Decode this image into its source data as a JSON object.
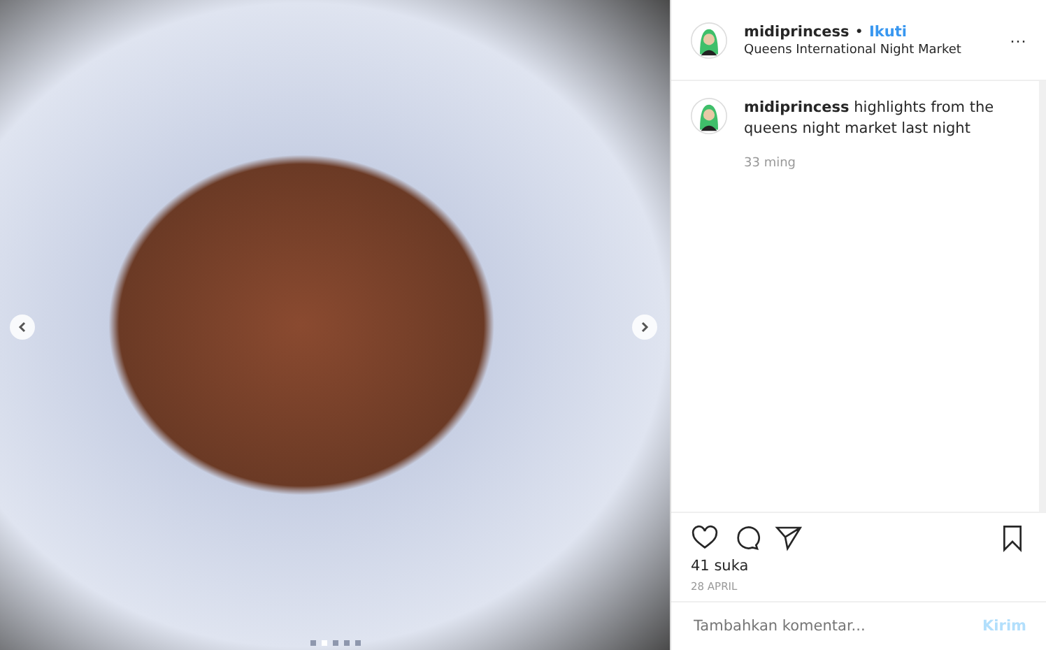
{
  "post": {
    "username": "midiprincess",
    "separator": "•",
    "follow": "Ikuti",
    "location": "Queens International Night Market",
    "more": "···"
  },
  "carousel": {
    "slides": [
      {
        "selected": false
      },
      {
        "selected": true
      },
      {
        "selected": false
      },
      {
        "selected": false
      },
      {
        "selected": false
      }
    ]
  },
  "caption": {
    "username": "midiprincess",
    "text": "highlights from the queens night market last night",
    "time": "33 ming"
  },
  "likes": "41 suka",
  "date": "28 APRIL",
  "comment_field": {
    "placeholder": "Tambahkan komentar...",
    "submit": "Kirim",
    "submit_disabled": true
  }
}
